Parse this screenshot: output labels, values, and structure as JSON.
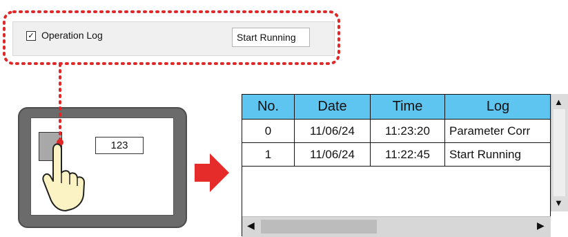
{
  "settings": {
    "checkbox_mark": "☑",
    "label": "Operation Log",
    "log_text": "Start Running"
  },
  "device": {
    "display_value": "123"
  },
  "log_table": {
    "headers": [
      "No.",
      "Date",
      "Time",
      "Log"
    ],
    "rows": [
      {
        "no": "0",
        "date": "11/06/24",
        "time": "11:23:20",
        "log": "Parameter Corr"
      },
      {
        "no": "1",
        "date": "11/06/24",
        "time": "11:22:45",
        "log": "Start Running"
      }
    ]
  },
  "icons": {
    "scroll_up": "▲",
    "scroll_down": "▼",
    "scroll_left": "◀",
    "scroll_right": "▶",
    "checkbox_check": "✓"
  },
  "colors": {
    "header_bg": "#5ec5f0",
    "callout_dots": "#e02828",
    "arrow": "#e62b2b",
    "device_frame": "#6b6b6b",
    "hand_fill": "#fbf3c3"
  }
}
